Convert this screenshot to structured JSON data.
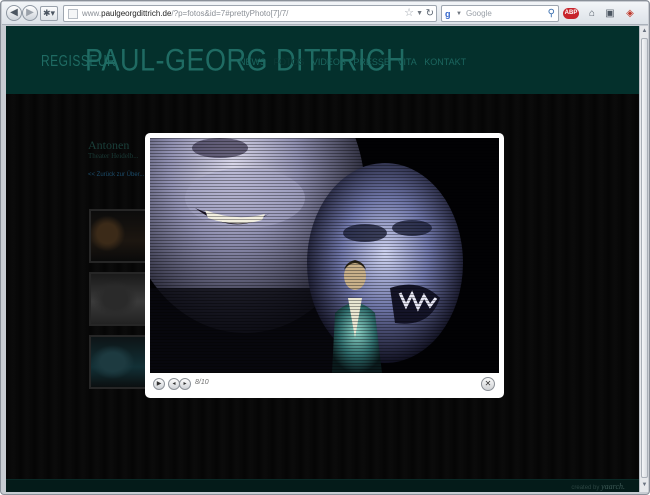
{
  "browser": {
    "url_prefix": "www.",
    "url_domain": "paulgeorgdittrich.de",
    "url_path": "/?p=fotos&id=7#prettyPhoto[7]/7/",
    "search_engine": "Google",
    "search_placeholder": "Google"
  },
  "site": {
    "subtitle": "REGISSEUR",
    "title": "PAUL-GEORG DITTRICH",
    "nav": [
      "NEWS",
      "FOTOS",
      "VIDEOS",
      "PRESSE",
      "VITA",
      "KONTAKT"
    ],
    "active_nav_index": 1,
    "page_title": "Antonen",
    "page_subtitle": "Theater Heidelb...",
    "back_link": "<< Zurück zur Über...",
    "credit_text": "created by",
    "credit_name": "yaarch."
  },
  "lightbox": {
    "counter": "8/10"
  },
  "colors": {
    "header_teal": "#04302c",
    "title_teal": "#1f6b63",
    "lightbox_bg": "#ffffff"
  }
}
